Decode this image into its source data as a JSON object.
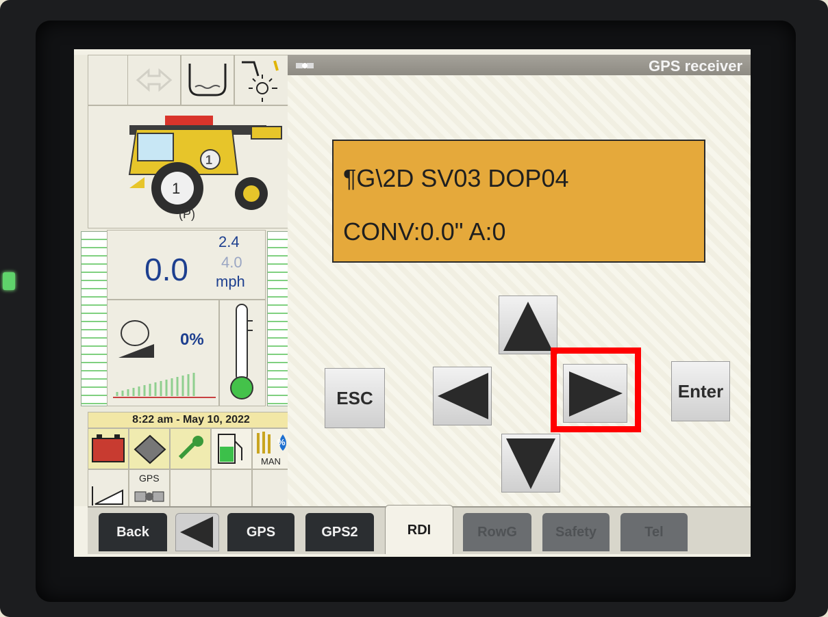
{
  "window": {
    "title": "GPS receiver"
  },
  "lcd": {
    "line1": "¶G\\2D  SV03 DOP04",
    "line2": "CONV:0.0\" A:0"
  },
  "keys": {
    "esc": "ESC",
    "enter": "Enter"
  },
  "status": {
    "speed": "0.0",
    "speed_top": "2.4",
    "speed_bottom": "4.0",
    "unit": "mph",
    "percent": "0%",
    "park": "(P)",
    "combine_number": "1",
    "datetime": "8:22 am - May 10, 2022",
    "gps_label": "GPS",
    "man_label": "MAN",
    "percent_badge": "%"
  },
  "tabs": [
    {
      "label": "Back",
      "state": "normal"
    },
    {
      "label": "GPS",
      "state": "normal"
    },
    {
      "label": "GPS2",
      "state": "normal"
    },
    {
      "label": "RDI",
      "state": "active"
    },
    {
      "label": "RowG",
      "state": "disabled"
    },
    {
      "label": "Safety",
      "state": "disabled"
    },
    {
      "label": "Tel",
      "state": "disabled"
    }
  ],
  "colors": {
    "lcd": "#e5a93b",
    "highlight": "#ff0000",
    "speed": "#1d3f8f",
    "tab_dark": "#2b2e31"
  }
}
